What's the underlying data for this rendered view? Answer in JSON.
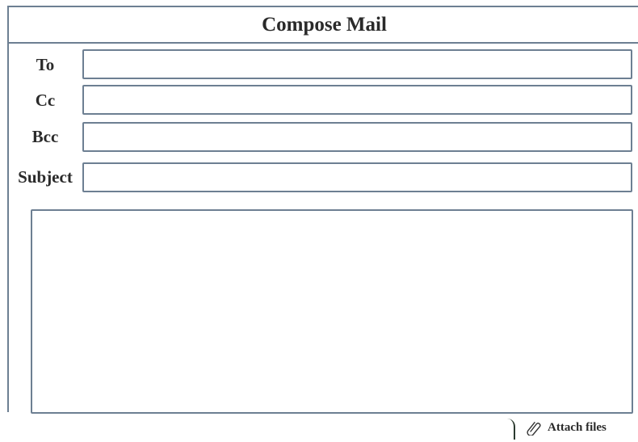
{
  "compose": {
    "title": "Compose Mail",
    "fields": {
      "to": {
        "label": "To",
        "value": ""
      },
      "cc": {
        "label": "Cc",
        "value": ""
      },
      "bcc": {
        "label": "Bcc",
        "value": ""
      },
      "subject": {
        "label": "Subject",
        "value": ""
      }
    },
    "body": {
      "value": ""
    }
  },
  "footer": {
    "attach_label": "Attach files",
    "attach_icon": "paperclip-icon"
  },
  "colors": {
    "border": "#6d7f92",
    "text": "#2a2a2a",
    "background": "#ffffff"
  }
}
